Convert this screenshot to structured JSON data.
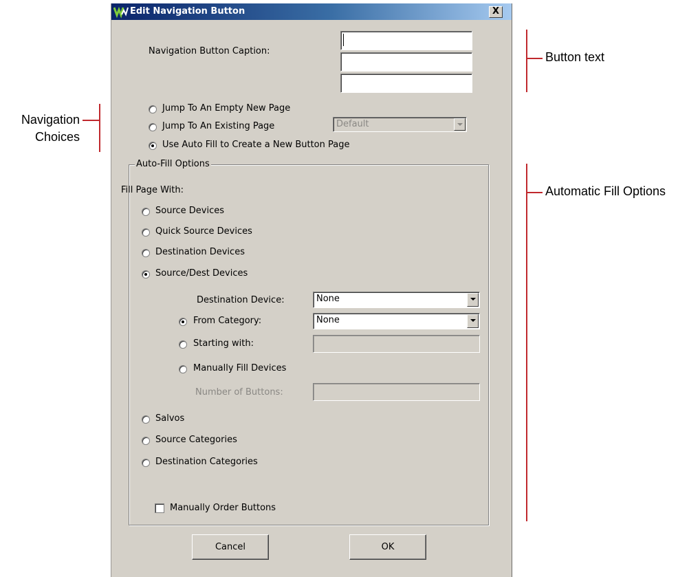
{
  "dialog": {
    "title": "Edit Navigation Button",
    "close_label": "X"
  },
  "caption_section": {
    "label": "Navigation Button Caption:",
    "line1_value": "",
    "line2_value": "",
    "line3_value": ""
  },
  "navigation_choices": {
    "options": [
      {
        "label": "Jump To An Empty New Page",
        "selected": false
      },
      {
        "label": "Jump To An Existing Page",
        "selected": false
      },
      {
        "label": "Use Auto Fill to Create a New Button Page",
        "selected": true
      }
    ],
    "existing_page_select": "Default"
  },
  "auto_fill": {
    "group_title": "Auto-Fill Options",
    "fill_label": "Fill Page With:",
    "options": [
      {
        "label": "Source Devices",
        "selected": false
      },
      {
        "label": "Quick Source Devices",
        "selected": false
      },
      {
        "label": "Destination Devices",
        "selected": false
      },
      {
        "label": "Source/Dest Devices",
        "selected": true
      }
    ],
    "destination_device_label": "Destination Device:",
    "destination_device_value": "None",
    "sub_options": [
      {
        "label": "From Category:",
        "selected": true
      },
      {
        "label": "Starting with:",
        "selected": false
      },
      {
        "label": "Manually Fill Devices",
        "selected": false
      }
    ],
    "from_category_value": "None",
    "starting_with_value": "",
    "number_of_buttons_label": "Number of Buttons:",
    "number_of_buttons_value": "",
    "more_options": [
      {
        "label": "Salvos",
        "selected": false
      },
      {
        "label": "Source Categories",
        "selected": false
      },
      {
        "label": "Destination Categories",
        "selected": false
      }
    ],
    "manually_order_label": "Manually Order Buttons",
    "manually_order_checked": false
  },
  "buttons": {
    "cancel": "Cancel",
    "ok": "OK"
  },
  "annotations": {
    "button_text": "Button text",
    "navigation_choices_line1": "Navigation",
    "navigation_choices_line2": "Choices",
    "automatic_fill": "Automatic Fill Options"
  },
  "colors": {
    "annotation_line": "#c0282d",
    "dialog_bg": "#d4d0c8",
    "titlebar_start": "#0a246a"
  }
}
